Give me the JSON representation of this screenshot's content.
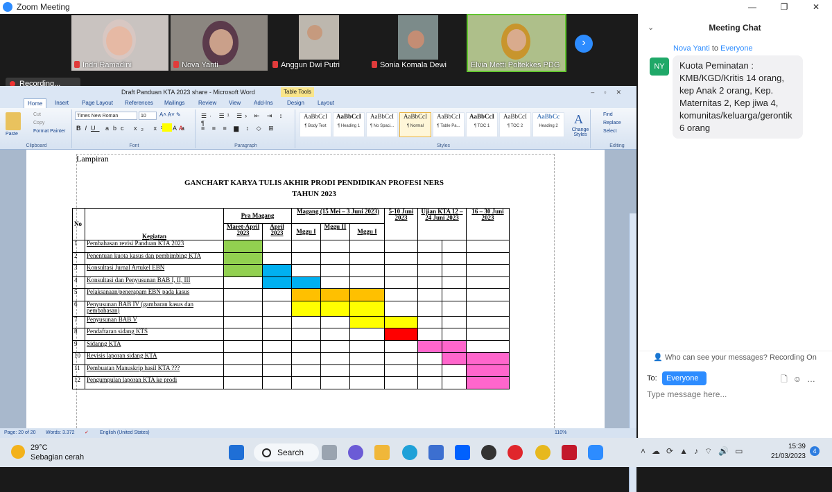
{
  "window": {
    "title": "Zoom Meeting"
  },
  "participants": [
    {
      "name": "Indri Ramadini",
      "muted": true
    },
    {
      "name": "Nova Yanti",
      "muted": true
    },
    {
      "name": "Anggun Dwi Putri",
      "muted": true
    },
    {
      "name": "Sonia Komala Dewi",
      "muted": true
    },
    {
      "name": "Elvia Metti Poltekkes PDG",
      "muted": false
    }
  ],
  "recording": {
    "label": "Recording..."
  },
  "word": {
    "title": "Draft Panduan KTA 2023 share - Microsoft Word",
    "context_tab": "Table Tools",
    "tabs": [
      "Home",
      "Insert",
      "Page Layout",
      "References",
      "Mailings",
      "Review",
      "View",
      "Add-Ins",
      "Design",
      "Layout"
    ],
    "clipboard": {
      "paste": "Paste",
      "cut": "Cut",
      "copy": "Copy",
      "format_painter": "Format Painter",
      "label": "Clipboard"
    },
    "font": {
      "name": "Times New Roman",
      "size": "10",
      "label": "Font"
    },
    "paragraph_label": "Paragraph",
    "styles": [
      {
        "preview": "AaBbCcI",
        "name": "¶ Body Text"
      },
      {
        "preview": "AaBbCcI",
        "name": "¶ Heading 1"
      },
      {
        "preview": "AaBbCcI",
        "name": "¶ No Spaci..."
      },
      {
        "preview": "AaBbCcI",
        "name": "¶ Normal"
      },
      {
        "preview": "AaBbCcI",
        "name": "¶ Table Pa..."
      },
      {
        "preview": "AaBbCcI",
        "name": "¶ TOC 1"
      },
      {
        "preview": "AaBbCcI",
        "name": "¶ TOC 2"
      },
      {
        "preview": "AaBbCc",
        "name": "Heading 2"
      }
    ],
    "styles_label": "Styles",
    "change_styles": "Change Styles",
    "editing": {
      "find": "Find",
      "replace": "Replace",
      "select": "Select",
      "label": "Editing"
    },
    "status": {
      "page": "Page: 20 of 20",
      "words": "Words: 3.372",
      "language": "English (United States)",
      "zoom": "110%"
    }
  },
  "document": {
    "lampiran": "Lampiran",
    "heading1": "GANCHART KARYA TULIS AKHIR PRODI PENDIDIKAN PROFESI NERS",
    "heading2": "TAHUN 2023",
    "table": {
      "h_no": "No",
      "h_kegiatan": "Kegiatan",
      "h_pra": "Pra Magang",
      "h_maret": "Maret-April 2023",
      "h_april": "April 2023",
      "h_magang": "Magang (15 Mei – 3 Juni 2023)",
      "h_m1": "Mggu I",
      "h_m2": "Mggu II",
      "h_m3": "Mggu I",
      "h_510": "5-10 Juni 2023",
      "h_ujian": "Ujian KTA 12 – 24 Juni 2023",
      "h_1630": "16 – 30 Juni 2023",
      "rows": [
        {
          "no": "1",
          "kegiatan": "Pembahasan revisi Panduan KTA 2023"
        },
        {
          "no": "2",
          "kegiatan": "Penentuan kuota kasus dan pembimbing KTA"
        },
        {
          "no": "3",
          "kegiatan": "Konsultasi Jurnal Artukel EBN"
        },
        {
          "no": "4",
          "kegiatan": "Konsultasi dan Penyusunan BAB I, II, III"
        },
        {
          "no": "5",
          "kegiatan": "Pelaksanaan/penerapam EBN pada kasus"
        },
        {
          "no": "6",
          "kegiatan": "Penyusunan BAB IV (gambaran kasus dan pembahasan)"
        },
        {
          "no": "7",
          "kegiatan": "Penyusunan BAB V"
        },
        {
          "no": "8",
          "kegiatan": "Pendaftaran sidang KTS"
        },
        {
          "no": "9",
          "kegiatan": "Sidanng KTA"
        },
        {
          "no": "10",
          "kegiatan": "Revisis laporan sidang KTA"
        },
        {
          "no": "11",
          "kegiatan": "Pembuatan Manuskrip hasil KTA ???"
        },
        {
          "no": "12",
          "kegiatan": "Pengumpulan laporan KTA ke prodi"
        }
      ],
      "colors": {
        "green": "#92d050",
        "blue": "#00b0f0",
        "orange": "#ffc000",
        "yellow": "#ffff00",
        "red": "#ff0000",
        "pink": "#ff66cc"
      }
    }
  },
  "chat": {
    "title": "Meeting Chat",
    "sender": "Nova Yanti",
    "to_word": "to",
    "recipient": "Everyone",
    "avatar": "NY",
    "message": "Kuota Peminatan : KMB/KGD/Kritis 14 orang, kep Anak 2 orang, Kep. Maternitas 2, Kep jiwa 4, komunitas/keluarga/gerontik 6 orang",
    "who_can_see": "Who can see your messages? Recording On",
    "to_label": "To:",
    "to_value": "Everyone",
    "placeholder": "Type message here..."
  },
  "taskbar": {
    "temp": "29°C",
    "weather": "Sebagian cerah",
    "search": "Search",
    "time": "15:39",
    "date": "21/03/2023",
    "notifications": "4"
  }
}
